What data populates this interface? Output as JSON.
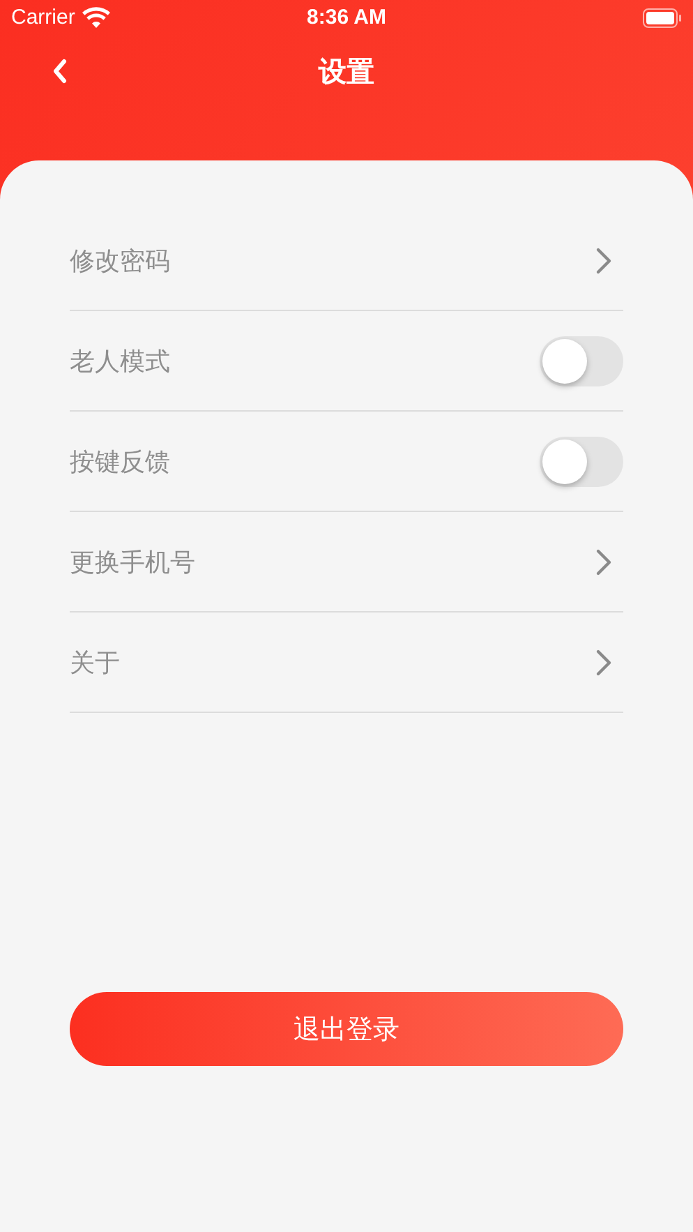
{
  "status_bar": {
    "carrier": "Carrier",
    "time": "8:36 AM"
  },
  "nav": {
    "title": "设置"
  },
  "settings": [
    {
      "kind": "link",
      "label": "修改密码"
    },
    {
      "kind": "toggle",
      "label": "老人模式",
      "on": false
    },
    {
      "kind": "toggle",
      "label": "按键反馈",
      "on": false
    },
    {
      "kind": "link",
      "label": "更换手机号"
    },
    {
      "kind": "link",
      "label": "关于"
    }
  ],
  "logout_button": {
    "label": "退出登录"
  }
}
